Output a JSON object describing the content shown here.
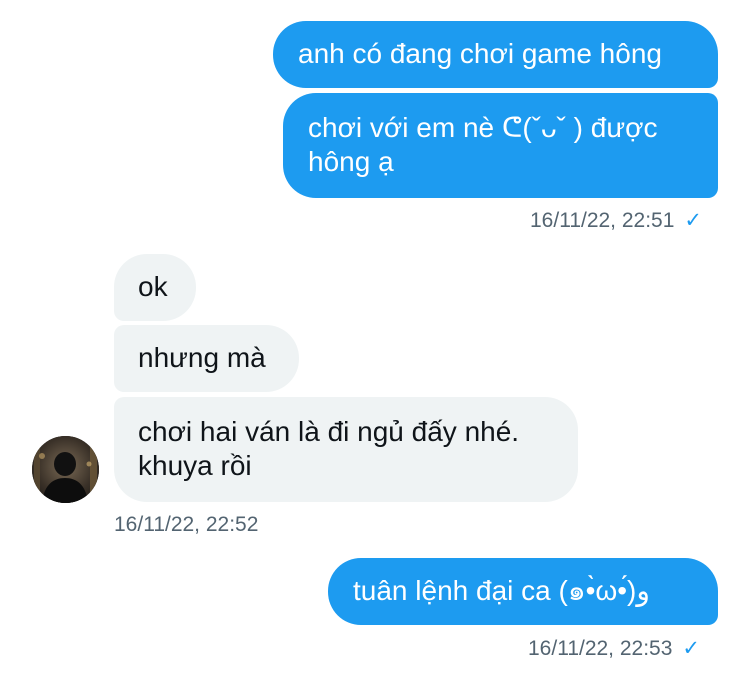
{
  "conversation": {
    "outgoing_group_1": {
      "messages": [
        "anh có đang chơi game hông",
        "chơi với em nè ᕦ(ˇᴗˇ ) được\nhông ạ"
      ],
      "timestamp": "16/11/22, 22:51",
      "status_icon": "check-icon"
    },
    "incoming_group": {
      "messages": [
        "ok",
        "nhưng mà",
        "chơi hai ván là đi ngủ đấy nhé.\nkhuya rồi"
      ],
      "timestamp": "16/11/22, 22:52",
      "avatar_icon": "avatar"
    },
    "outgoing_group_2": {
      "messages": [
        "tuân lệnh đại ca (๑•̀ω•́)و"
      ],
      "timestamp": "16/11/22, 22:53",
      "status_icon": "check-icon"
    }
  },
  "colors": {
    "outgoing_bubble": "#1d9bf0",
    "incoming_bubble": "#eff3f4",
    "timestamp_text": "#536471",
    "tick": "#1d9bf0"
  }
}
